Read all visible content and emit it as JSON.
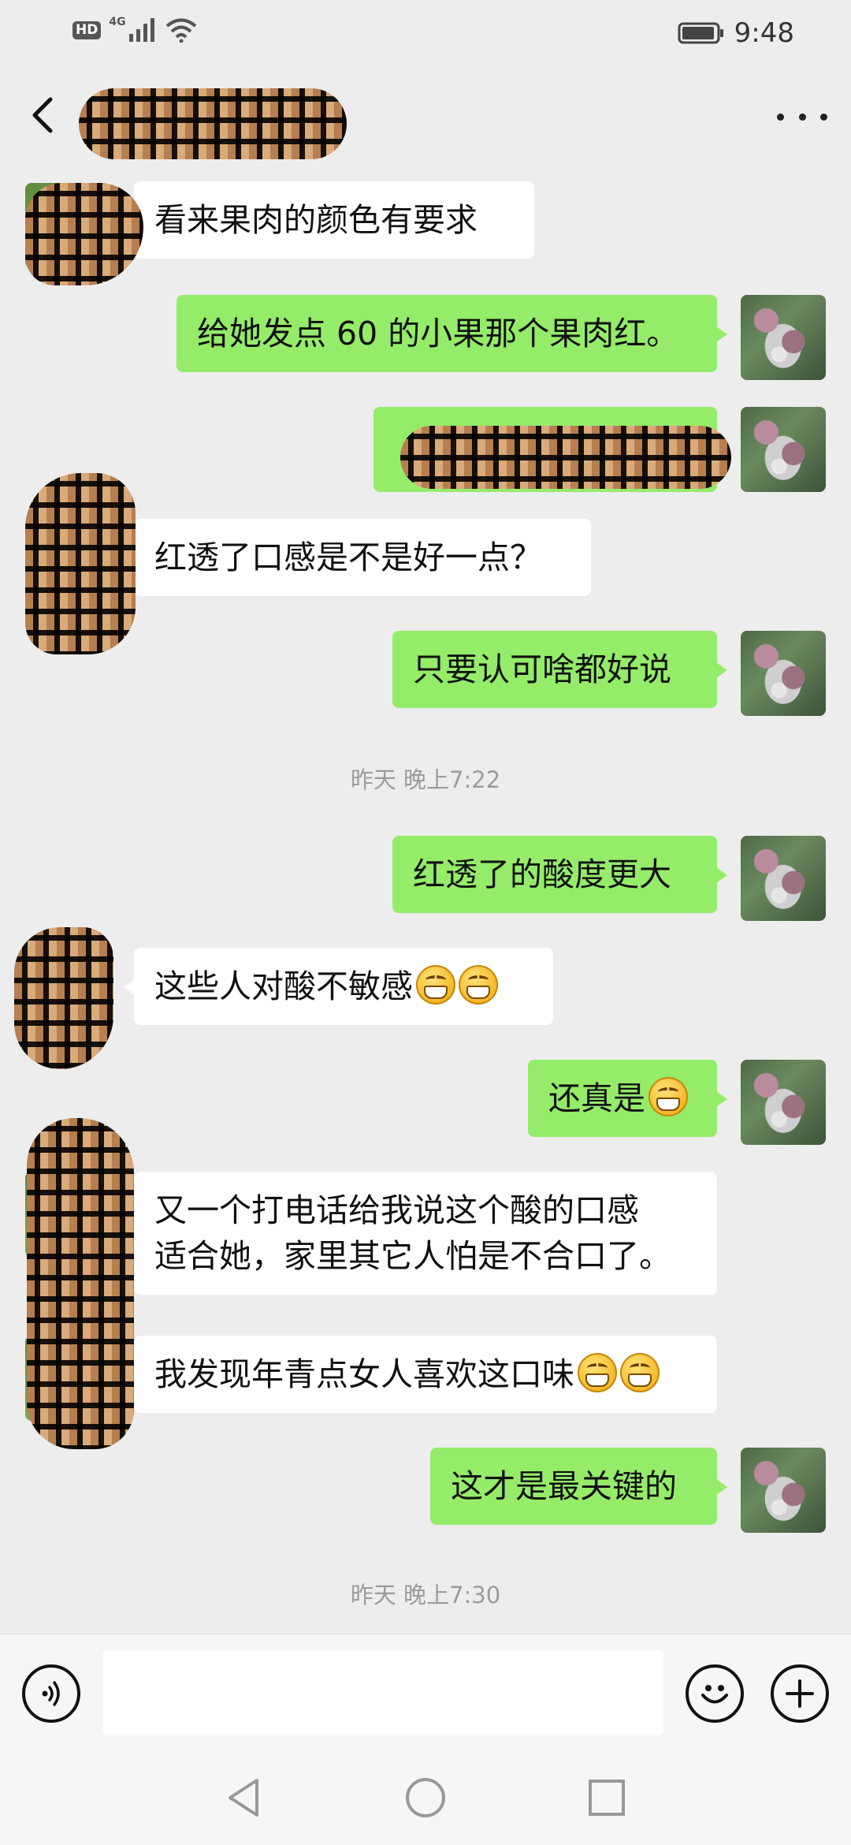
{
  "status_bar": {
    "network_badge": "HD",
    "network_type": "4G",
    "time": "9:48",
    "icons": [
      "hd-icon",
      "signal-icon",
      "wifi-icon",
      "battery-icon"
    ]
  },
  "header": {
    "back_icon": "back-arrow-icon",
    "more_icon": "more-dots-icon"
  },
  "messages": [
    {
      "sender": "other",
      "text": "看来果肉的颜色有要求"
    },
    {
      "sender": "me",
      "text": "给她发点 60 的小果那个果肉红。"
    },
    {
      "sender": "me",
      "text": ""
    },
    {
      "sender": "other",
      "text": "红透了口感是不是好一点？"
    },
    {
      "sender": "me",
      "text": "只要认可啥都好说"
    },
    {
      "timestamp": "昨天 晚上7:22"
    },
    {
      "sender": "me",
      "text": "红透了的酸度更大"
    },
    {
      "sender": "other",
      "text": "这些人对酸不敏感"
    },
    {
      "sender": "me",
      "text": "还真是"
    },
    {
      "sender": "other",
      "text_line1": "又一个打电话给我说这个酸的口感",
      "text_line2": "适合她，家里其它人怕是不合口了。"
    },
    {
      "sender": "other",
      "text": "我发现年青点女人喜欢这口味"
    },
    {
      "sender": "me",
      "text": "这才是最关键的"
    },
    {
      "timestamp": "昨天 晚上7:30"
    }
  ],
  "input_bar": {
    "voice_icon": "voice-icon",
    "emoji_icon": "emoji-icon",
    "plus_icon": "plus-icon",
    "input_value": ""
  },
  "nav_bar": {
    "icons": [
      "nav-back-icon",
      "nav-home-icon",
      "nav-recents-icon"
    ]
  },
  "colors": {
    "background": "#ededed",
    "outgoing_bubble": "#95ec69",
    "incoming_bubble": "#ffffff",
    "timestamp_text": "#9b9b9b"
  }
}
